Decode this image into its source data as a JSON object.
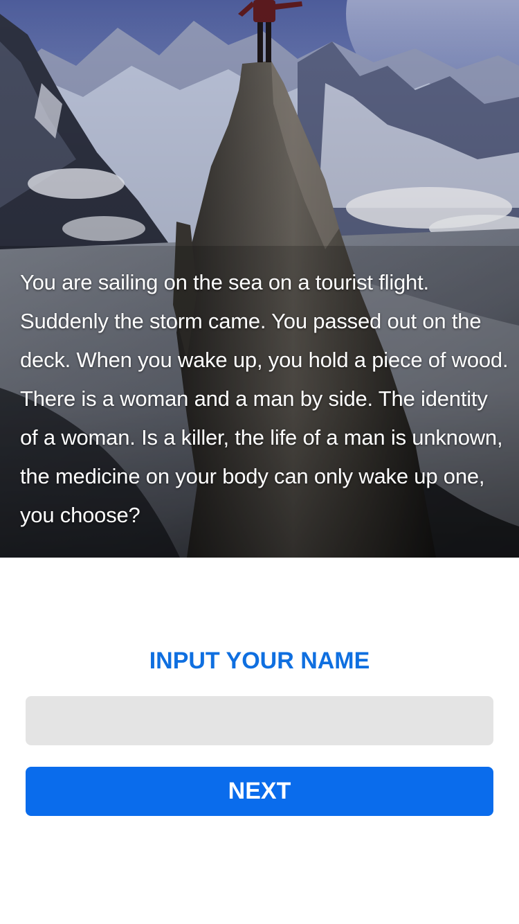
{
  "hero": {
    "image": "mountain-climber-on-rock-spire",
    "story": "You are sailing on the sea on a tourist flight. Suddenly the storm came. You passed out on the deck. When you wake up, you hold a piece of wood. There is a woman and a man by side. The identity of a woman. Is a killer, the life of a man is unknown, the medicine on your body can only wake up one, you choose?"
  },
  "form": {
    "title": "INPUT YOUR NAME",
    "name_value": "",
    "name_placeholder": "",
    "next_label": "NEXT"
  },
  "colors": {
    "accent": "#0f6fe0",
    "button": "#0a6cec",
    "input_bg": "#e4e4e4",
    "sky_top": "#6f80b8",
    "rock": "#4f4c48"
  }
}
